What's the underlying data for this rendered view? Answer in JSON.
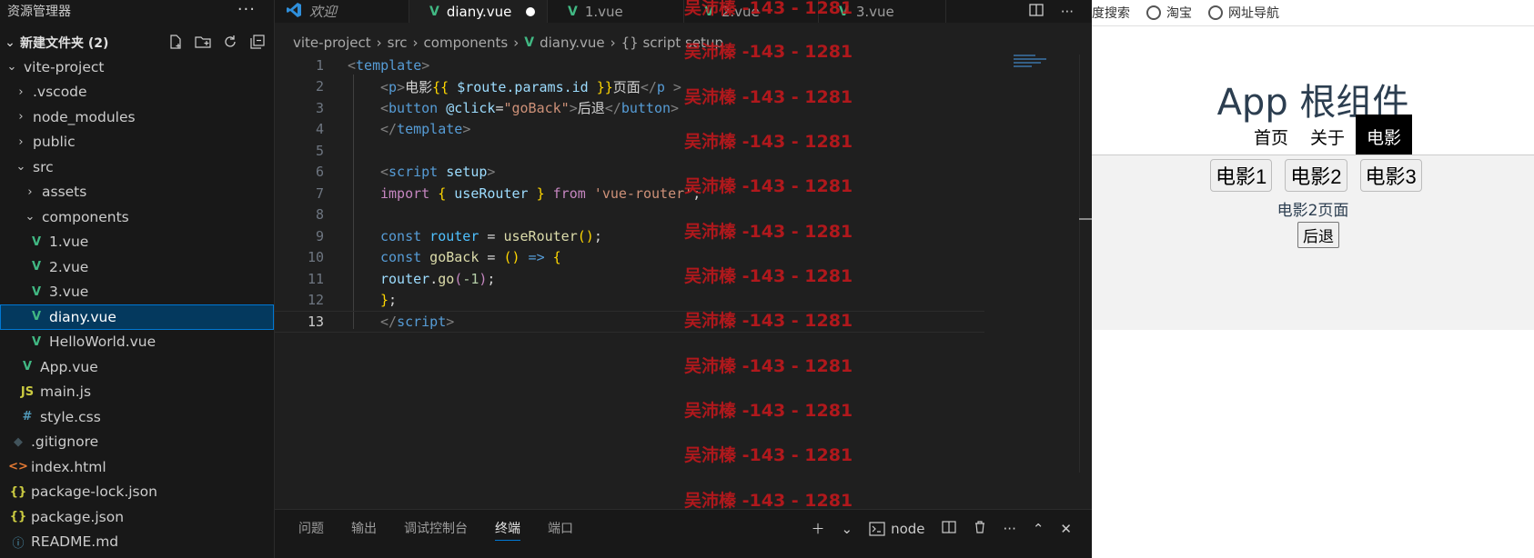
{
  "sidebar": {
    "title": "资源管理器",
    "folder": "新建文件夹 (2)",
    "tree": [
      {
        "label": "vite-project",
        "depth": 0,
        "type": "folder-open"
      },
      {
        "label": ".vscode",
        "depth": 1,
        "type": "folder"
      },
      {
        "label": "node_modules",
        "depth": 1,
        "type": "folder"
      },
      {
        "label": "public",
        "depth": 1,
        "type": "folder"
      },
      {
        "label": "src",
        "depth": 1,
        "type": "folder-open"
      },
      {
        "label": "assets",
        "depth": 2,
        "type": "folder"
      },
      {
        "label": "components",
        "depth": 2,
        "type": "folder-open"
      },
      {
        "label": "1.vue",
        "depth": 3,
        "type": "vue"
      },
      {
        "label": "2.vue",
        "depth": 3,
        "type": "vue"
      },
      {
        "label": "3.vue",
        "depth": 3,
        "type": "vue"
      },
      {
        "label": "diany.vue",
        "depth": 3,
        "type": "vue",
        "selected": true
      },
      {
        "label": "HelloWorld.vue",
        "depth": 3,
        "type": "vue"
      },
      {
        "label": "App.vue",
        "depth": 2,
        "type": "vue"
      },
      {
        "label": "main.js",
        "depth": 2,
        "type": "js"
      },
      {
        "label": "style.css",
        "depth": 2,
        "type": "css"
      },
      {
        "label": ".gitignore",
        "depth": 1,
        "type": "git"
      },
      {
        "label": "index.html",
        "depth": 1,
        "type": "html"
      },
      {
        "label": "package-lock.json",
        "depth": 1,
        "type": "json"
      },
      {
        "label": "package.json",
        "depth": 1,
        "type": "json"
      },
      {
        "label": "README.md",
        "depth": 1,
        "type": "info"
      }
    ]
  },
  "tabs": {
    "welcome": "欢迎",
    "diany": "diany.vue",
    "one": "1.vue",
    "two": "2.vue",
    "three": "3.vue"
  },
  "breadcrumb": {
    "project": "vite-project",
    "src": "src",
    "components": "components",
    "file": "diany.vue",
    "symbol": "{} script setup"
  },
  "code": {
    "line_numbers": [
      "1",
      "2",
      "3",
      "4",
      "5",
      "6",
      "7",
      "8",
      "9",
      "10",
      "11",
      "12",
      "13"
    ],
    "l1": {
      "t1": "<",
      "tag": "template",
      "t2": ">"
    },
    "l2": {
      "lt": "<",
      "tag": "p",
      "gt": ">",
      "text": "电影",
      "ob": "{{",
      "expr": " $route.params.id ",
      "cb": "}}",
      "text2": "页面",
      "close_lt": "</",
      "close_tag": "p",
      "close_gt": " >"
    },
    "l3": {
      "lt": "<",
      "tag": "button",
      "attr": " @click",
      "eq": "=",
      "val": "\"goBack\"",
      "gt": ">",
      "text": "后退",
      "close_lt": "</",
      "close_tag": "button",
      "close_gt": ">"
    },
    "l4": {
      "lt": "</",
      "tag": "template",
      "gt": ">"
    },
    "l6": {
      "lt": "<",
      "tag": "script",
      "attr": " setup",
      "gt": ">"
    },
    "l7": {
      "kw": "import",
      "ob": " { ",
      "id": "useRouter",
      "cb": " } ",
      "from": "from",
      "str": " 'vue-router'",
      "end": ";"
    },
    "l9": {
      "kw": "const",
      "id": " router",
      "eq": " = ",
      "fn": "useRouter",
      "args": "()",
      "end": ";"
    },
    "l10": {
      "kw": "const",
      "id": " goBack",
      "eq": " = ",
      "args": "()",
      "arrow": " => ",
      "ob": "{"
    },
    "l11": {
      "obj": "router",
      "dot": ".",
      "fn": "go",
      "op": "(",
      "num": "-1",
      "cp": ")",
      "end": ";"
    },
    "l12": {
      "cb": "}",
      "end": ";"
    },
    "l13": {
      "lt": "</",
      "tag": "script",
      "gt": ">"
    }
  },
  "panel": {
    "tabs": [
      "问题",
      "输出",
      "调试控制台",
      "终端",
      "端口"
    ],
    "active_tab": "终端",
    "terminal": "node"
  },
  "browser": {
    "bookmarks": [
      "度搜索",
      "淘宝",
      "网址导航"
    ],
    "app_title": "App 根组件",
    "nav": [
      "首页",
      "关于",
      "电影"
    ],
    "active_nav": "电影",
    "movie_buttons": [
      "电影1",
      "电影2",
      "电影3"
    ],
    "movie_text": "电影2页面",
    "back_button": "后退"
  },
  "watermark": {
    "text": "吴沛榛 -143 - 1281",
    "color": "#c0181c"
  },
  "colors": {
    "selection": "#04395e",
    "accent": "#0078d4",
    "vue": "#41b883"
  }
}
